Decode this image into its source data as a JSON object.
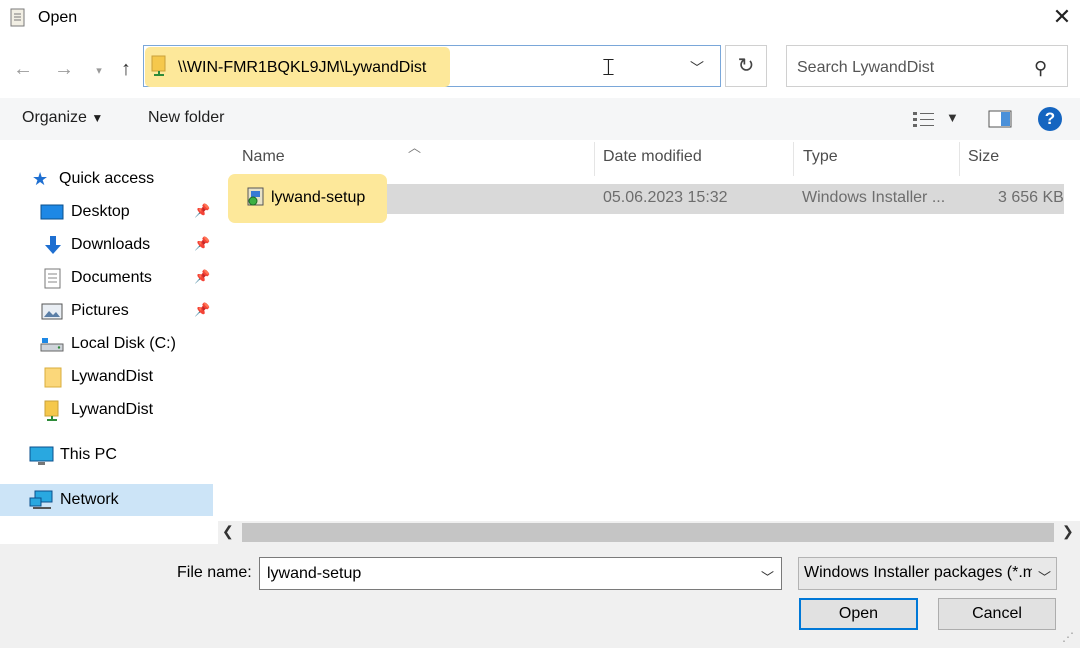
{
  "window": {
    "title": "Open",
    "close_glyph": "✕"
  },
  "nav": {
    "address": "\\\\WIN-FMR1BQKL9JM\\LywandDist",
    "search_placeholder": "Search LywandDist"
  },
  "toolbar": {
    "organize": "Organize",
    "new_folder": "New folder"
  },
  "sidebar": {
    "quick_access": "Quick access",
    "items": [
      {
        "label": "Desktop",
        "icon": "desktop-icon",
        "pinned": true
      },
      {
        "label": "Downloads",
        "icon": "downloads-icon",
        "pinned": true
      },
      {
        "label": "Documents",
        "icon": "documents-icon",
        "pinned": true
      },
      {
        "label": "Pictures",
        "icon": "pictures-icon",
        "pinned": true
      },
      {
        "label": "Local Disk (C:)",
        "icon": "drive-icon",
        "pinned": false
      },
      {
        "label": "LywandDist",
        "icon": "folder-icon",
        "pinned": false
      },
      {
        "label": "LywandDist",
        "icon": "network-folder-icon",
        "pinned": false
      }
    ],
    "this_pc": "This PC",
    "network": "Network"
  },
  "columns": {
    "name": "Name",
    "date": "Date modified",
    "type": "Type",
    "size": "Size"
  },
  "files": [
    {
      "name": "lywand-setup",
      "date": "05.06.2023 15:32",
      "type": "Windows Installer ...",
      "size": "3 656 KB",
      "icon": "msi-installer-icon"
    }
  ],
  "bottom": {
    "file_name_label": "File name:",
    "file_name_value": "lywand-setup",
    "file_type": "Windows Installer packages (*.msi)",
    "open": "Open",
    "cancel": "Cancel"
  },
  "colors": {
    "highlight": "#fde89a",
    "selection": "#d9d9d9",
    "accent": "#0078d7"
  }
}
